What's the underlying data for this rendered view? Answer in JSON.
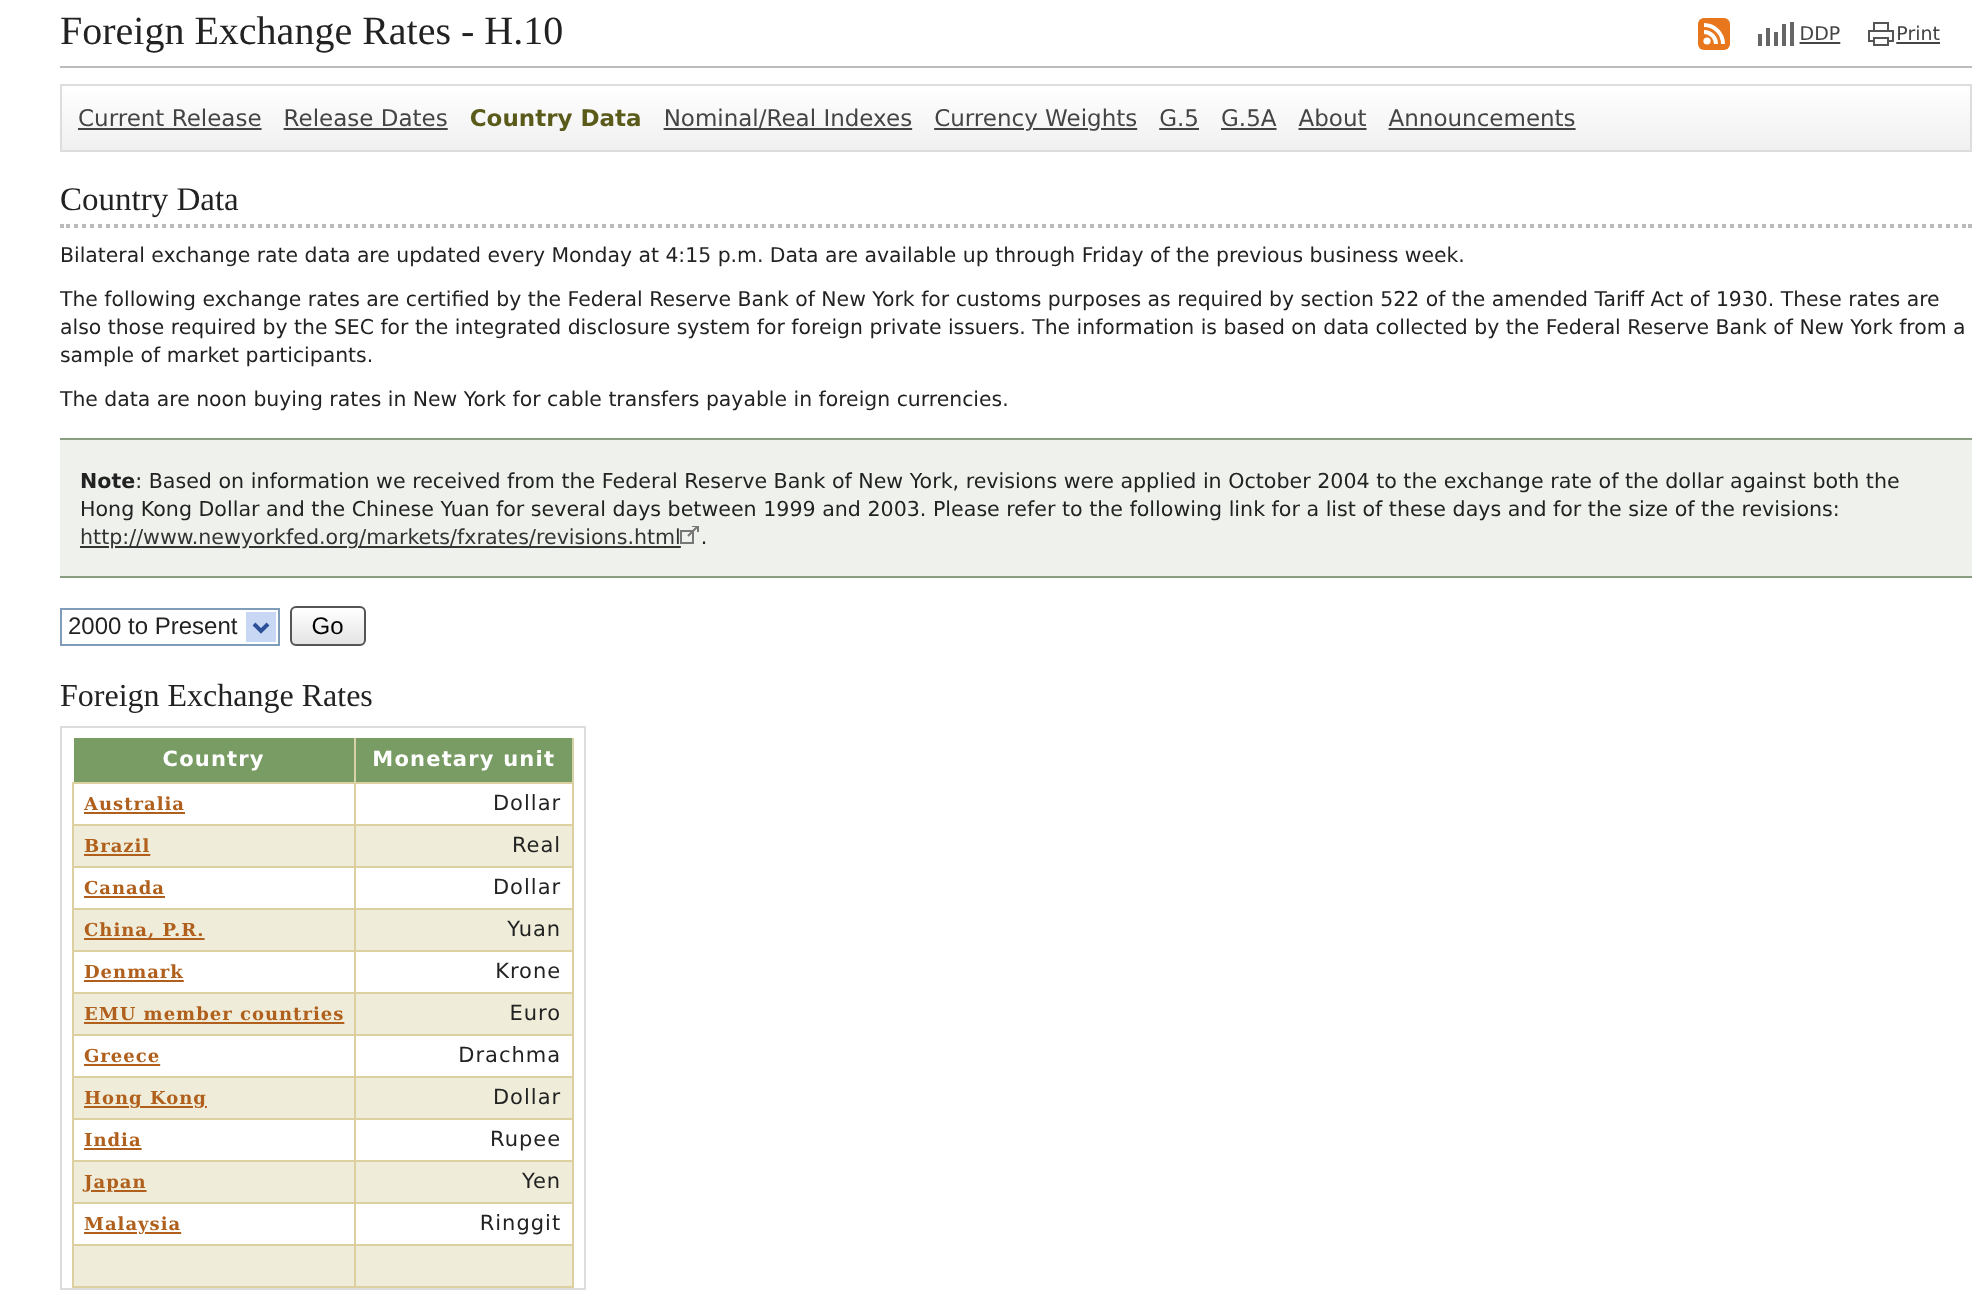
{
  "page_title": "Foreign Exchange Rates - H.10",
  "header_links": [
    {
      "kind": "rss"
    },
    {
      "kind": "ddp",
      "label": "DDP"
    },
    {
      "kind": "print",
      "label": "Print"
    }
  ],
  "nav": [
    {
      "label": "Current Release",
      "selected": false
    },
    {
      "label": "Release Dates",
      "selected": false
    },
    {
      "label": "Country Data",
      "selected": true
    },
    {
      "label": "Nominal/Real Indexes",
      "selected": false
    },
    {
      "label": "Currency Weights",
      "selected": false
    },
    {
      "label": "G.5",
      "selected": false
    },
    {
      "label": "G.5A",
      "selected": false
    },
    {
      "label": "About",
      "selected": false
    },
    {
      "label": "Announcements",
      "selected": false
    }
  ],
  "section_title": "Country Data",
  "paragraphs": [
    "Bilateral exchange rate data are updated every Monday at 4:15 p.m. Data are available up through Friday of the previous business week.",
    "The following exchange rates are certified by the Federal Reserve Bank of New York for customs purposes as required by section 522 of the amended Tariff Act of 1930. These rates are also those required by the SEC for the integrated disclosure system for foreign private issuers. The information is based on data collected by the Federal Reserve Bank of New York from a sample of market participants.",
    "The data are noon buying rates in New York for cable transfers payable in foreign currencies."
  ],
  "note": {
    "text": "**Note**: Based on information we received from the Federal Reserve Bank of New York, revisions were applied in October 2004 to the exchange rate of the dollar against both the Hong Kong Dollar and the Chinese Yuan for several days between 1999 and 2003. Please refer to the following link for a list of these days and for the size of the revisions: ",
    "link": "http://www.newyorkfed.org/markets/fxrates/revisions.html",
    "end": "."
  },
  "period_select": {
    "value": "2000 to Present"
  },
  "go_button": "Go",
  "table_title": "Foreign Exchange Rates",
  "table": {
    "columns": [
      "Country",
      "Monetary unit"
    ],
    "rows": [
      [
        "Australia",
        "Dollar"
      ],
      [
        "Brazil",
        "Real"
      ],
      [
        "Canada",
        "Dollar"
      ],
      [
        "China, P.R.",
        "Yuan"
      ],
      [
        "Denmark",
        "Krone"
      ],
      [
        "EMU member countries",
        "Euro"
      ],
      [
        "Greece",
        "Drachma"
      ],
      [
        "Hong Kong",
        "Dollar"
      ],
      [
        "India",
        "Rupee"
      ],
      [
        "Japan",
        "Yen"
      ],
      [
        "Malaysia",
        "Ringgit"
      ]
    ]
  }
}
